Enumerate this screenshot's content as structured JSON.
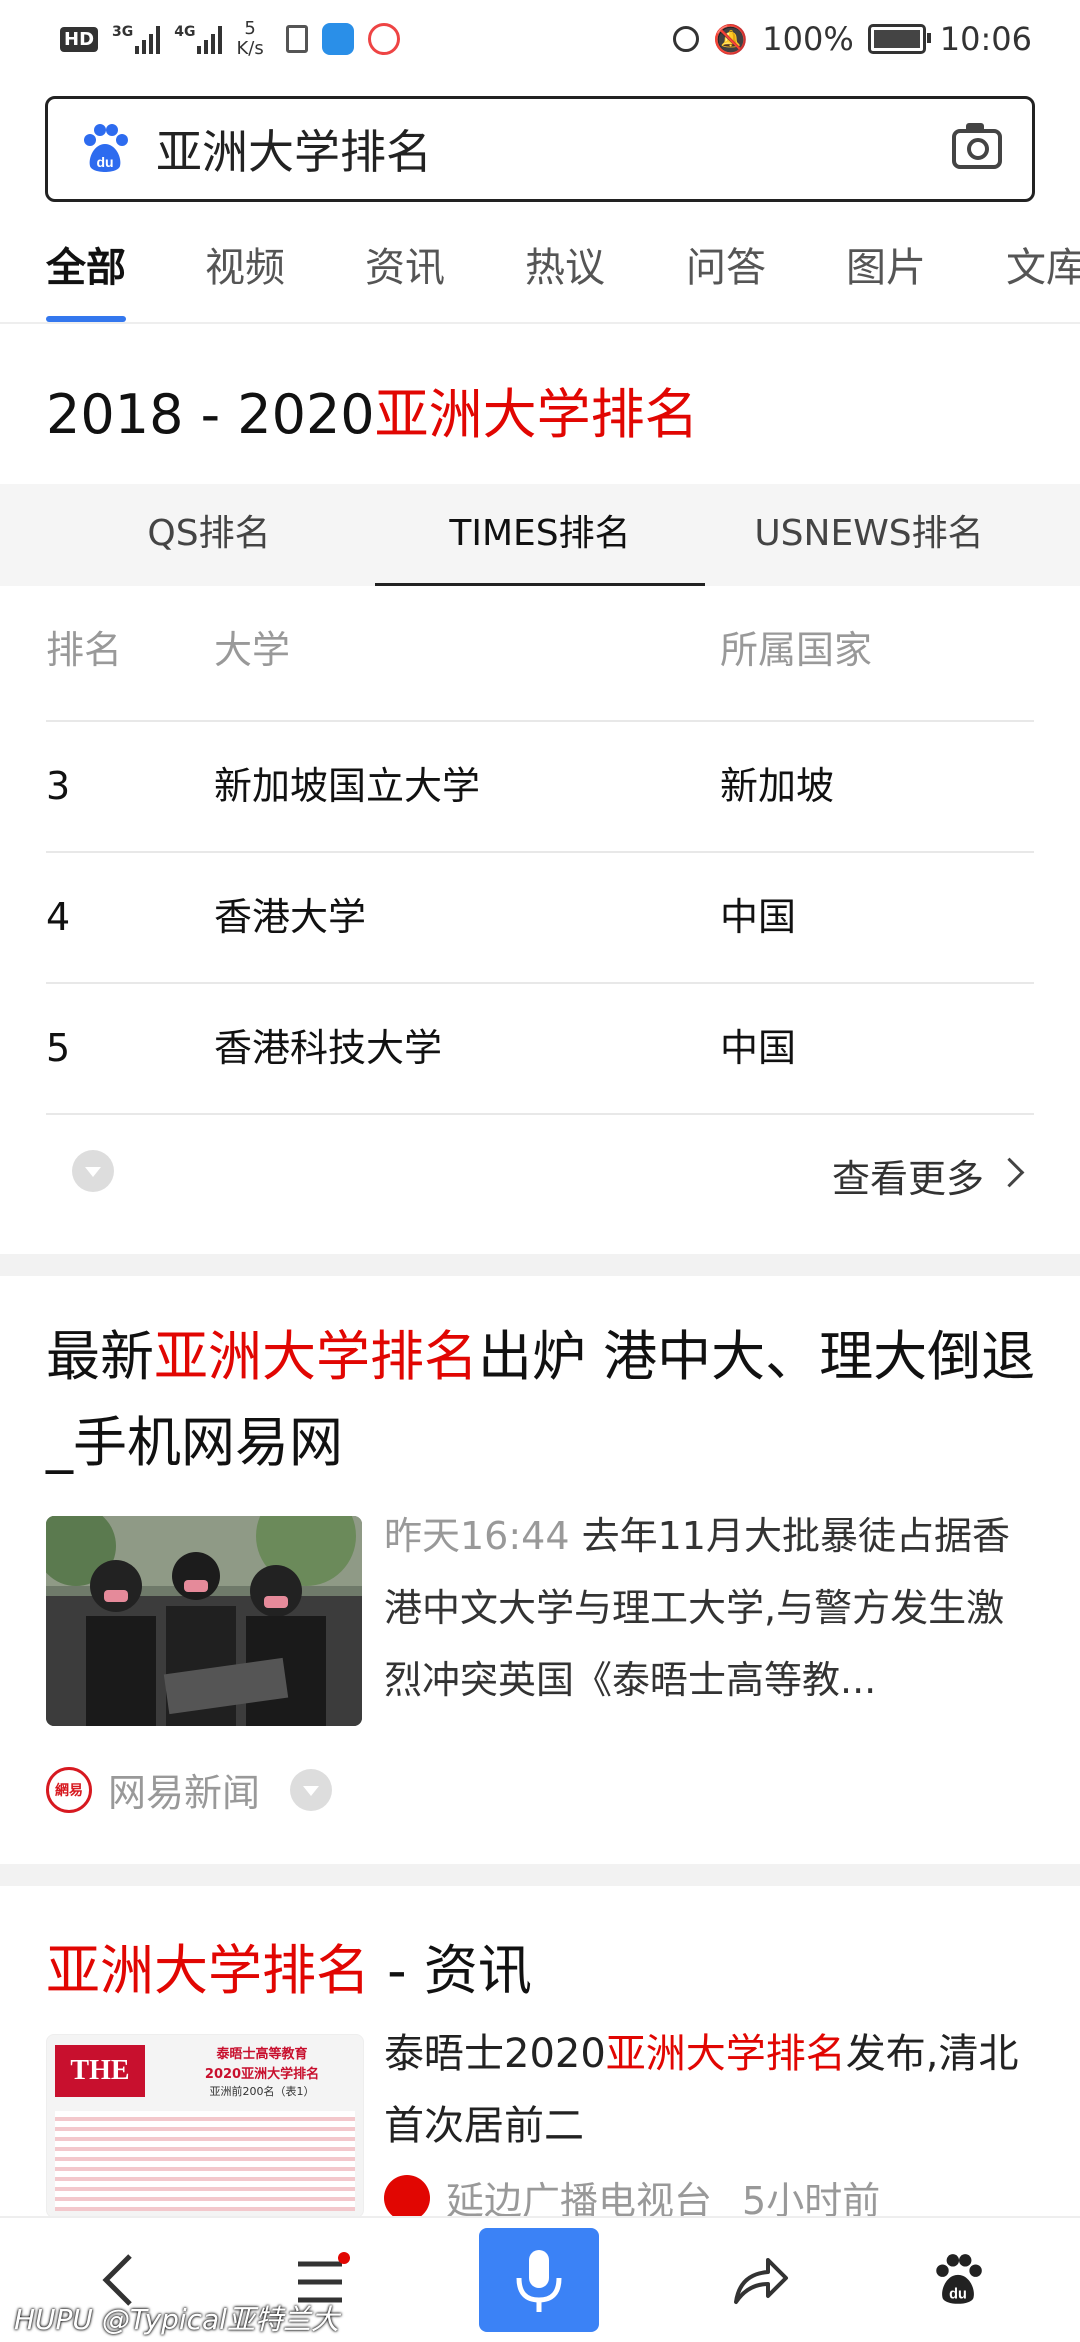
{
  "status_bar": {
    "hd_label": "HD",
    "net1": "3G",
    "net2": "4G",
    "speed_value": "5",
    "speed_unit": "K/s",
    "battery": "100%",
    "time": "10:06"
  },
  "search": {
    "query": "亚洲大学排名"
  },
  "tabs": [
    {
      "label": "全部",
      "active": true
    },
    {
      "label": "视频"
    },
    {
      "label": "资讯"
    },
    {
      "label": "热议"
    },
    {
      "label": "问答"
    },
    {
      "label": "图片"
    },
    {
      "label": "文库"
    }
  ],
  "ranking_card": {
    "title_prefix": "2018 - 2020",
    "title_highlight": "亚洲大学排名",
    "rank_tabs": [
      "QS排名",
      "TIMES排名",
      "USNEWS排名"
    ],
    "active_tab": "TIMES排名",
    "columns": [
      "排名",
      "大学",
      "所属国家"
    ],
    "rows": [
      {
        "rank": "3",
        "university": "新加坡国立大学",
        "country": "新加坡"
      },
      {
        "rank": "4",
        "university": "香港大学",
        "country": "中国"
      },
      {
        "rank": "5",
        "university": "香港科技大学",
        "country": "中国"
      }
    ],
    "more_label": "查看更多"
  },
  "news1": {
    "title_pre": "最新",
    "title_highlight": "亚洲大学排名",
    "title_post": "出炉 港中大、理大倒退_手机网易网",
    "time": "昨天16:44",
    "snippet": "去年11月大批暴徒占据香港中文大学与理工大学,与警方发生激烈冲突英国《泰晤士高等教...",
    "source": "网易新闻",
    "source_logo_text": "網易"
  },
  "news2": {
    "title_highlight": "亚洲大学排名",
    "title_post": " - 资讯",
    "snippet_pre": "泰晤士2020",
    "snippet_highlight": "亚洲大学排名",
    "snippet_post": "发布,清北首次居前二",
    "source": "延边广播电视台",
    "time": "5小时前",
    "thumb_logo": "THE",
    "thumb_title1": "泰晤士高等教育",
    "thumb_title2": "2020亚洲大学排名",
    "thumb_title3": "亚洲前200名（表1）"
  },
  "watermark": "HUPU @Typical亚特兰大",
  "colors": {
    "accent_blue": "#3377ee",
    "highlight_red": "#e10602",
    "mic_blue": "#3b82f6"
  }
}
